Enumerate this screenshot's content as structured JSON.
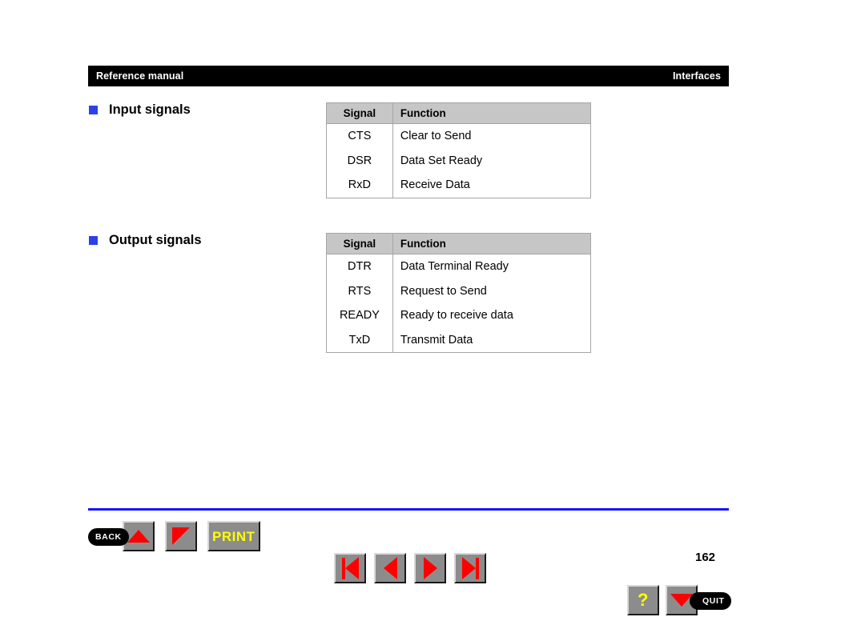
{
  "header": {
    "left_text": "Reference manual",
    "right_text": "Interfaces"
  },
  "sections": [
    {
      "id": "input",
      "title": "Input signals",
      "bullet_color": "#2b40e8",
      "table": {
        "columns": [
          "Signal",
          "Function"
        ],
        "rows": [
          [
            "CTS",
            "Clear to Send"
          ],
          [
            "DSR",
            "Data Set Ready"
          ],
          [
            "RxD",
            "Receive Data"
          ]
        ]
      }
    },
    {
      "id": "output",
      "title": "Output signals",
      "bullet_color": "#2b40e8",
      "table": {
        "columns": [
          "Signal",
          "Function"
        ],
        "rows": [
          [
            "DTR",
            "Data Terminal Ready"
          ],
          [
            "RTS",
            "Request to Send"
          ],
          [
            "READY",
            "Ready to receive data"
          ],
          [
            "TxD",
            "Transmit Data"
          ]
        ]
      }
    }
  ],
  "navigation": {
    "back_label": "BACK",
    "print_label": "PRINT",
    "help_label": "?",
    "quit_label": "QUIT",
    "icons": {
      "scroll_up": "triangle-up-icon",
      "scroll_down": "triangle-corner-icon",
      "first_page": "first-page-icon",
      "previous_page": "previous-page-icon",
      "next_page": "next-page-icon",
      "last_page": "last-page-icon",
      "quit_arrow": "triangle-down-icon"
    },
    "accent_color": "#ff0000",
    "label_color": "#ffff00",
    "rule_color": "#1414ff"
  },
  "page_number": "162"
}
